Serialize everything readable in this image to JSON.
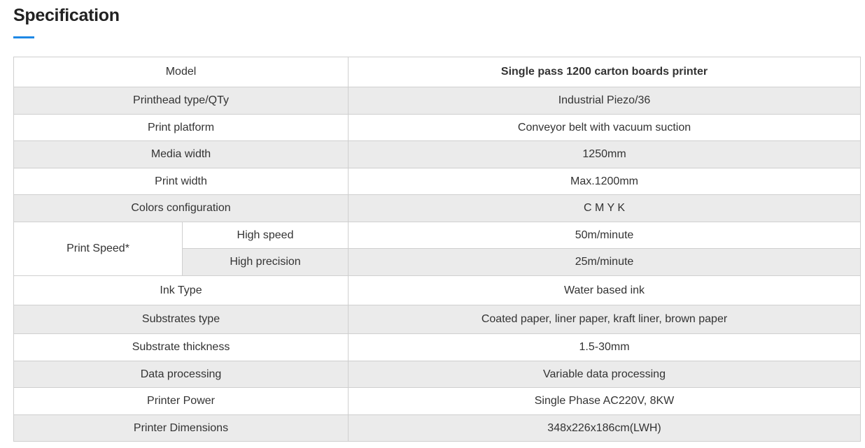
{
  "page": {
    "title": "Specification",
    "accent_color": "#1e88e5"
  },
  "spec": {
    "header": {
      "label": "Model",
      "value": "Single pass 1200 carton boards printer"
    },
    "rows_before": [
      {
        "label": "Printhead type/QTy",
        "value": "Industrial Piezo/36"
      },
      {
        "label": "Print platform",
        "value": "Conveyor belt with vacuum suction"
      },
      {
        "label": "Media width",
        "value": "1250mm"
      },
      {
        "label": "Print width",
        "value": "Max.1200mm"
      },
      {
        "label": "Colors configuration",
        "value": "C M Y K"
      }
    ],
    "print_speed": {
      "label": "Print Speed*",
      "modes": [
        {
          "label": "High speed",
          "value": "50m/minute"
        },
        {
          "label": "High precision",
          "value": "25m/minute"
        }
      ]
    },
    "rows_after": [
      {
        "label": "Ink Type",
        "value": "Water based ink"
      },
      {
        "label": "Substrates type",
        "value": "Coated paper, liner paper, kraft liner, brown paper"
      },
      {
        "label": "Substrate thickness",
        "value": "1.5-30mm"
      },
      {
        "label": "Data processing",
        "value": "Variable data processing"
      },
      {
        "label": "Printer Power",
        "value": "Single Phase AC220V, 8KW"
      },
      {
        "label": "Printer Dimensions",
        "value": "348x226x186cm(LWH)"
      }
    ]
  }
}
